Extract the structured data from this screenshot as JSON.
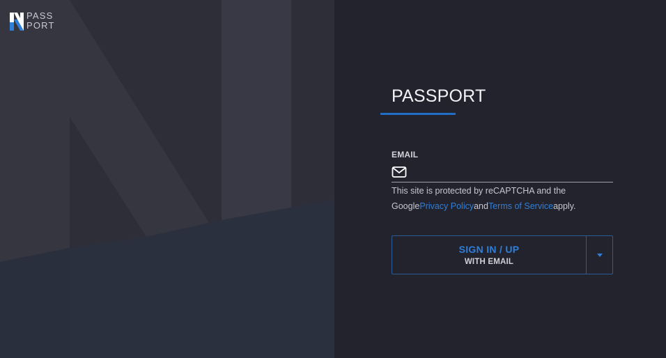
{
  "logo": {
    "line1": "PASS",
    "line2": "PORT"
  },
  "form": {
    "title": "PASSPORT",
    "email_label": "EMAIL",
    "email_value": "",
    "email_placeholder": ""
  },
  "recaptcha": {
    "prefix": "This site is protected by reCAPTCHA and the Google",
    "privacy_link": "Privacy Policy",
    "middle": "and",
    "terms_link": "Terms of Service",
    "suffix": "apply."
  },
  "signin": {
    "primary": "SIGN IN / UP",
    "secondary": "WITH EMAIL"
  },
  "icons": {
    "email": "envelope-icon",
    "dropdown": "caret-down-icon"
  },
  "colors": {
    "accent": "#1f6dc4",
    "link": "#2f7fd8",
    "background": "#23232e",
    "left_panel": "#2e2e39"
  }
}
